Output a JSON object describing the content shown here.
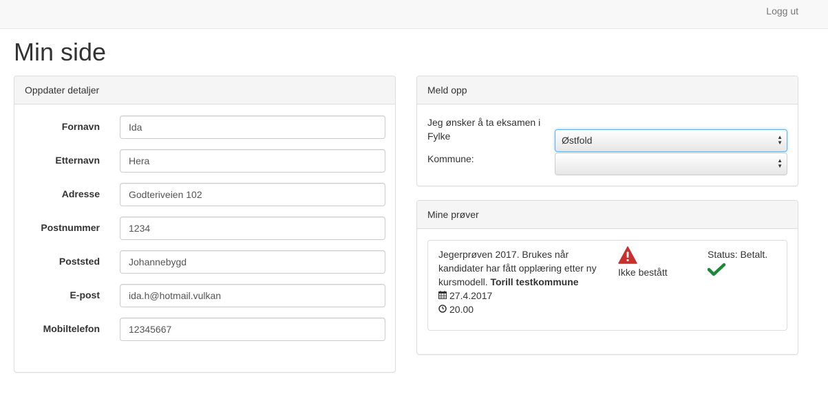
{
  "navbar": {
    "logout_label": "Logg ut"
  },
  "page": {
    "title": "Min side"
  },
  "details_panel": {
    "heading": "Oppdater detaljer",
    "fields": [
      {
        "label": "Fornavn",
        "value": "Ida"
      },
      {
        "label": "Etternavn",
        "value": "Hera"
      },
      {
        "label": "Adresse",
        "value": "Godteriveien 102"
      },
      {
        "label": "Postnummer",
        "value": "1234"
      },
      {
        "label": "Poststed",
        "value": "Johannebygd"
      },
      {
        "label": "E-post",
        "value": "ida.h@hotmail.vulkan"
      },
      {
        "label": "Mobiltelefon",
        "value": "12345667"
      }
    ]
  },
  "meld_panel": {
    "heading": "Meld opp",
    "exam_in_label": "Jeg ønsker å ta eksamen i",
    "fylke_label": "Fylke",
    "fylke_value": "Østfold",
    "kommune_label": "Kommune:",
    "kommune_value": ""
  },
  "prover_panel": {
    "heading": "Mine prøver",
    "exam": {
      "description": "Jegerprøven 2017. Brukes når kandidater har fått opplæring etter ny kursmodell.",
      "location": "Torill testkommune",
      "date": "27.4.2017",
      "time": "20.00",
      "result": "Ikke bestått",
      "status": "Status: Betalt.",
      "warning_icon": "warning-triangle-icon",
      "status_icon": "check-icon",
      "warning_color": "#c9302c",
      "check_color": "#1a8a3a"
    }
  }
}
